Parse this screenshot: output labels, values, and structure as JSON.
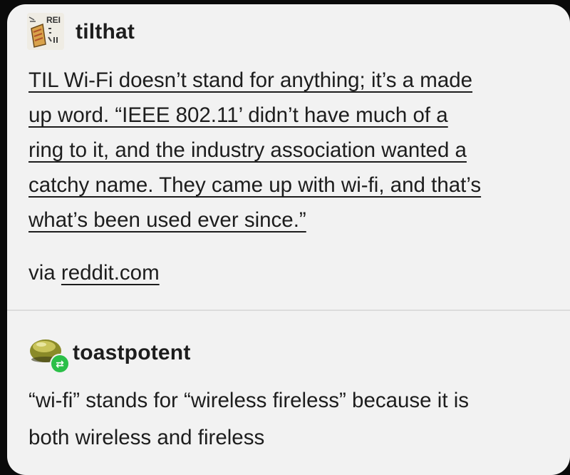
{
  "posts": [
    {
      "username": "tilthat",
      "avatar_icon": "reddit-til-logo-icon",
      "avatar_text": "REI",
      "lines": [
        "TIL Wi-Fi doesn’t stand for anything; it’s a made",
        "up word. “IEEE 802.11’ didn’t have much of a",
        "ring to it, and the industry association wanted a",
        "catchy name. They came up with wi-fi, and that’s",
        "what’s been used ever since.”"
      ],
      "source_prefix": "via",
      "source_link": "reddit.com"
    },
    {
      "username": "toastpotent",
      "avatar_icon": "green-blob-avatar-icon",
      "badge_icon": "reblog-icon",
      "lines": [
        "“wi-fi” stands for “wireless fireless” because it is",
        "both wireless and fireless"
      ]
    }
  ],
  "colors": {
    "card_background": "#f2f2f2",
    "text": "#1d1d1d",
    "reblog_badge": "#2bbf48",
    "outer_background": "#0a0a0a"
  }
}
